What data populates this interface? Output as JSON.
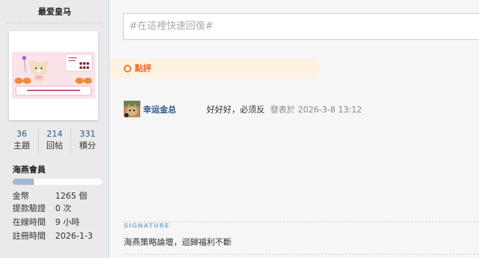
{
  "author": {
    "username": "最爱皇马",
    "stats": [
      {
        "value": "36",
        "label": "主題"
      },
      {
        "value": "214",
        "label": "回帖"
      },
      {
        "value": "331",
        "label": "積分"
      }
    ],
    "group": "海燕會員",
    "level_progress": 0.24,
    "details": [
      {
        "label": "金幣",
        "value": "1265 個"
      },
      {
        "label": "提款驗證",
        "value": "0 次"
      },
      {
        "label": "在線時間",
        "value": "9 小時"
      },
      {
        "label": "註冊時間",
        "value": "2026-1-3"
      }
    ]
  },
  "quick_reply": {
    "placeholder": "#在這裡快速回復#"
  },
  "comments": {
    "title": "點評",
    "items": [
      {
        "user": "幸运金总",
        "text": "好好好，必须反",
        "time": "發表於 2026-3-8 13:12"
      }
    ]
  },
  "signature": {
    "label": "SIGNATURE",
    "text": "海燕策略論壇，迴歸福利不斷"
  },
  "colors": {
    "link": "#2a5a8a",
    "comment_accent": "#f06a28",
    "comment_header_bg": "#fdf2e2",
    "level_bar": "#a4b8d6"
  },
  "icons": {
    "comment": "ring-icon"
  }
}
